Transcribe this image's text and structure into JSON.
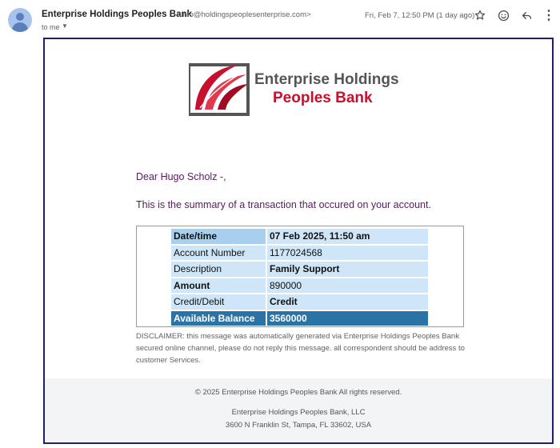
{
  "email": {
    "sender_name": "Enterprise Holdings Peoples Bank",
    "sender_email": "<info@holdingspeoplesenterprise.com>",
    "recipient": "to me",
    "date": "Fri, Feb 7, 12:50 PM (1 day ago)"
  },
  "icons": {
    "avatar": "person-avatar-icon",
    "star": "star-icon",
    "emoji": "emoji-icon",
    "reply": "reply-icon",
    "more": "more-vertical-icon"
  },
  "logo": {
    "line1": "Enterprise Holdings",
    "line2": "Peoples Bank",
    "colors": {
      "red": "#c8102e",
      "gray": "#555555"
    }
  },
  "body": {
    "greeting": "Dear Hugo Scholz -,",
    "summary": "This is the summary of a transaction that occured on your account."
  },
  "transaction": {
    "rows": [
      {
        "label": "Date/time",
        "value": "07 Feb 2025, 11:50 am"
      },
      {
        "label": "Account Number",
        "value": "1177024568"
      },
      {
        "label": "Description",
        "value": "Family Support"
      },
      {
        "label": "Amount",
        "value": "890000"
      },
      {
        "label": "Credit/Debit",
        "value": "Credit"
      },
      {
        "label": "Available Balance",
        "value": "3560000"
      }
    ],
    "colors": {
      "header_cell": "#a8d0ee",
      "light_cell": "#cfe6f8",
      "total_row": "#2a73a6"
    }
  },
  "disclaimer": "DISCLAIMER: this message was automatically generated via Enterprise Holdings Peoples Bank secured online channel, please do not reply this message. all correspondent should be address to customer Services.",
  "footer": {
    "copyright": "© 2025 Enterprise Holdings Peoples Bank All rights reserved.",
    "company": "Enterprise Holdings Peoples Bank, LLC",
    "address": "3600 N Franklin St, Tampa, FL 33602, USA"
  },
  "frame_border_color": "#1c1e6e"
}
